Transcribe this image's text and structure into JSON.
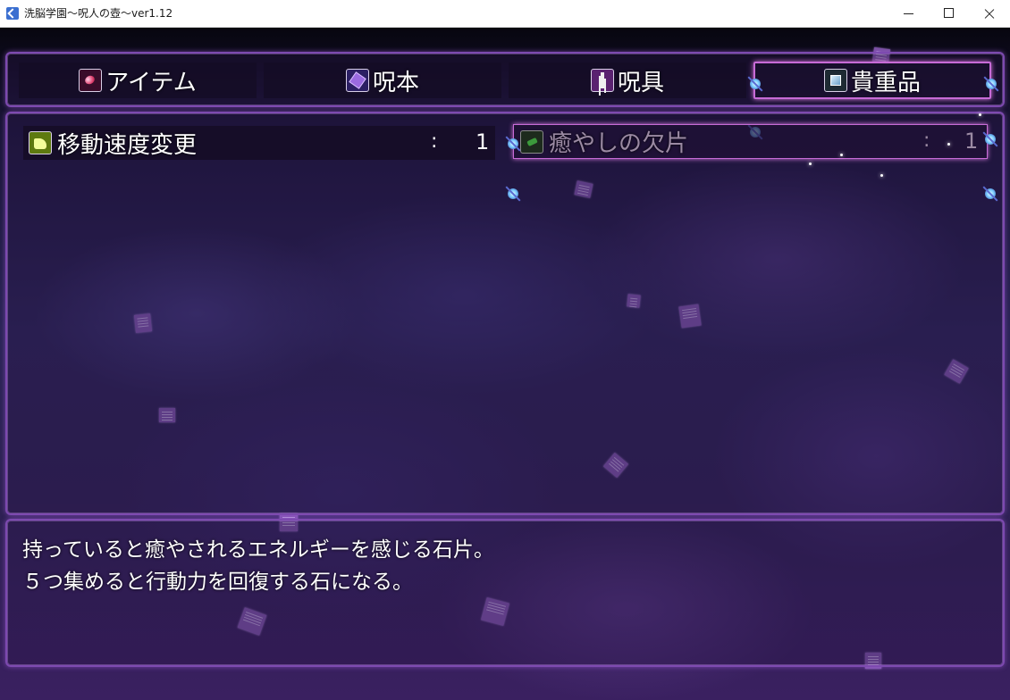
{
  "window": {
    "title": "洗脳学園～呪人の壺～ver1.12",
    "icon": "app-icon",
    "buttons": [
      "minimize-icon",
      "maximize-icon",
      "close-icon"
    ]
  },
  "tabs": [
    {
      "label": "アイテム",
      "icon": "gem-icon",
      "active": false
    },
    {
      "label": "呪本",
      "icon": "book-icon",
      "active": false
    },
    {
      "label": "呪具",
      "icon": "talisman-icon",
      "active": false
    },
    {
      "label": "貴重品",
      "icon": "valuable-icon",
      "active": true
    }
  ],
  "items": [
    {
      "name": "移動速度変更",
      "icon": "shoe-icon",
      "separator": ":",
      "count": "1",
      "selected": false
    },
    {
      "name": "癒やしの欠片",
      "icon": "shard-icon",
      "separator": ":",
      "count": "1",
      "selected": true
    }
  ],
  "help": {
    "line1": "持っていると癒やされるエネルギーを感じる石片。",
    "line2": "５つ集めると行動力を回復する石になる。"
  },
  "colors": {
    "frame": "#7d4ab0",
    "selection": "#c76bd6",
    "text": "#ffffff",
    "disabled_text": "#9b8aa3"
  }
}
